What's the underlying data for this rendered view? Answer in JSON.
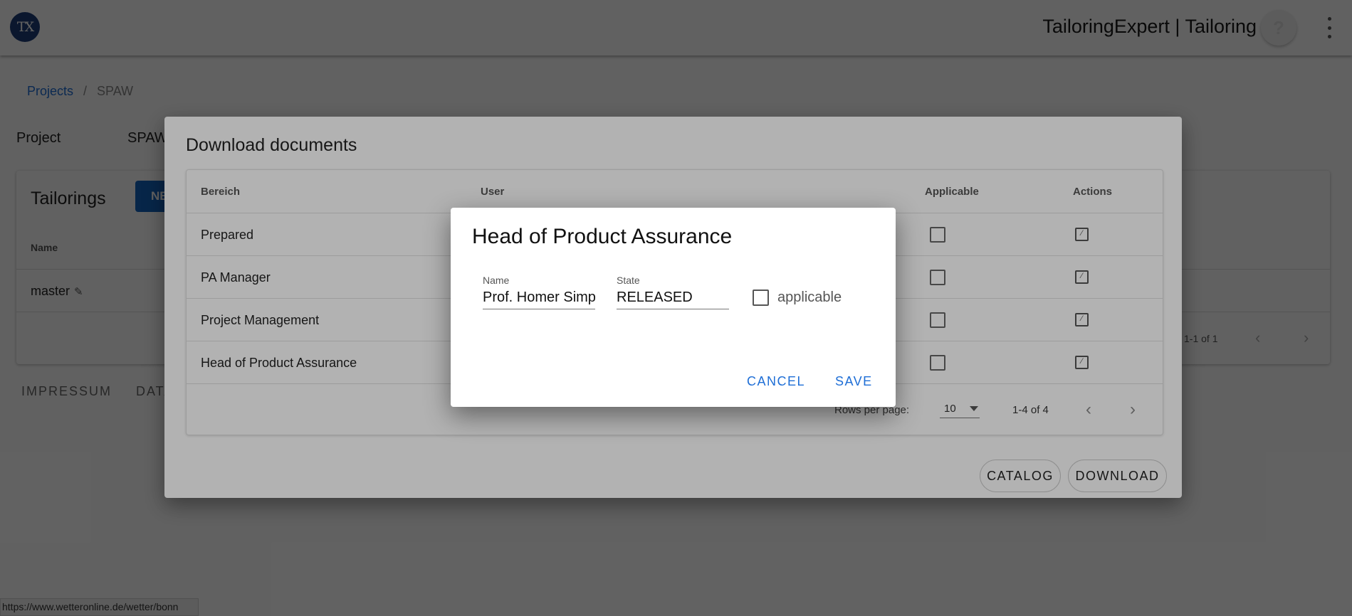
{
  "app": {
    "logo_text": "TX",
    "title": "TailoringExpert | Tailoring",
    "help_label": "?"
  },
  "breadcrumb": {
    "projects": "Projects",
    "separator": "/",
    "current": "SPAW"
  },
  "project": {
    "label": "Project",
    "value": "SPAW"
  },
  "tailorings": {
    "title": "Tailorings",
    "new_button": "NE",
    "column_name": "Name",
    "rows": [
      {
        "name": "master"
      }
    ],
    "range": "1-1 of 1"
  },
  "footer": {
    "impressum": "IMPRESSUM",
    "data": "DATA"
  },
  "status_url": "https://www.wetteronline.de/wetter/bonn",
  "download_dialog": {
    "title": "Download documents",
    "columns": {
      "bereich": "Bereich",
      "user": "User",
      "applicable": "Applicable",
      "actions": "Actions"
    },
    "rows": [
      {
        "bereich": "Prepared",
        "applicable": false
      },
      {
        "bereich": "PA Manager",
        "applicable": false
      },
      {
        "bereich": "Project Management",
        "applicable": false
      },
      {
        "bereich": "Head of Product Assurance",
        "applicable": false
      }
    ],
    "rows_per_page_label": "Rows per page:",
    "rows_per_page_value": "10",
    "range": "1-4 of 4",
    "catalog_button": "CATALOG",
    "download_button": "DOWNLOAD"
  },
  "edit_dialog": {
    "title": "Head of Product Assurance",
    "name_label": "Name",
    "name_value": "Prof. Homer Simp",
    "state_label": "State",
    "state_value": "RELEASED",
    "applicable_label": "applicable",
    "applicable_checked": false,
    "cancel_button": "CANCEL",
    "save_button": "SAVE"
  }
}
